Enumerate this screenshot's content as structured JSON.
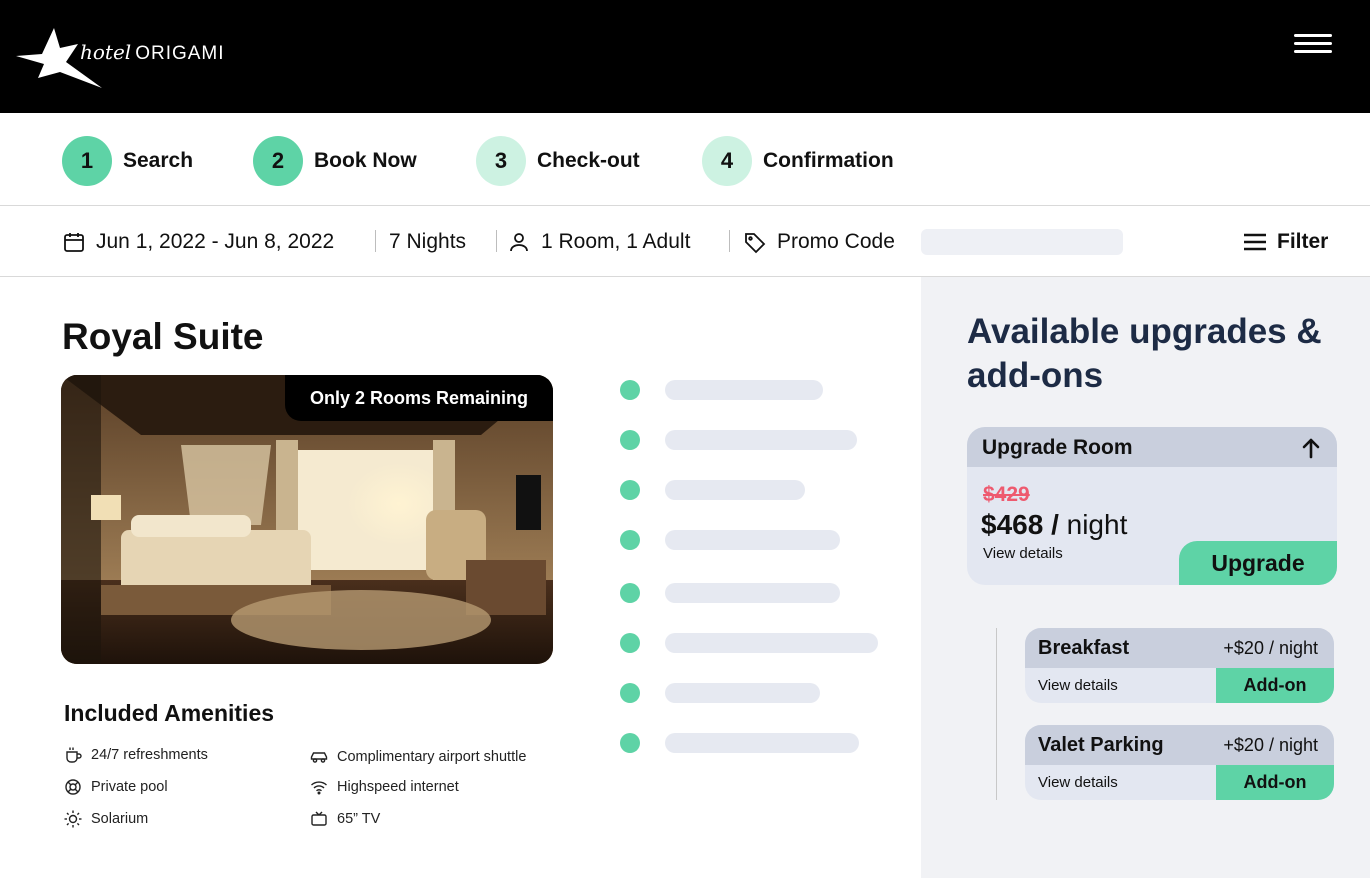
{
  "brand": {
    "hotel": "hotel",
    "name": "ORIGAMI"
  },
  "steps": [
    {
      "number": "1",
      "label": "Search"
    },
    {
      "number": "2",
      "label": "Book Now"
    },
    {
      "number": "3",
      "label": "Check-out"
    },
    {
      "number": "4",
      "label": "Confirmation"
    }
  ],
  "filterbar": {
    "dates": "Jun 1, 2022 - Jun 8, 2022",
    "nights": "7 Nights",
    "guests": "1 Room, 1 Adult",
    "promo_label": "Promo Code",
    "promo_value": "",
    "filter_label": "Filter"
  },
  "room": {
    "title": "Royal Suite",
    "badge": "Only 2 Rooms Remaining"
  },
  "amenities": {
    "title": "Included Amenities",
    "items": [
      {
        "icon": "cup-icon",
        "label": "24/7 refreshments"
      },
      {
        "icon": "car-icon",
        "label": "Complimentary airport shuttle"
      },
      {
        "icon": "lifebuoy-icon",
        "label": "Private pool"
      },
      {
        "icon": "wifi-icon",
        "label": "Highspeed internet"
      },
      {
        "icon": "sun-icon",
        "label": "Solarium"
      },
      {
        "icon": "tv-icon",
        "label": "65” TV"
      }
    ]
  },
  "panel": {
    "title": "Available upgrades & add-ons",
    "upgrade": {
      "header": "Upgrade Room",
      "old_price": "$429",
      "new_price": "$468 /",
      "per": "night",
      "details": "View details",
      "button": "Upgrade"
    },
    "addons": [
      {
        "name": "Breakfast",
        "price": "+$20 / night",
        "details": "View details",
        "button": "Add-on"
      },
      {
        "name": "Valet Parking",
        "price": "+$20 / night",
        "details": "View details",
        "button": "Add-on"
      }
    ]
  },
  "colors": {
    "accent": "#5ed3a6",
    "accent_light": "#cdf2e2",
    "strike": "#ee5a6f",
    "heading": "#1d2b45"
  }
}
